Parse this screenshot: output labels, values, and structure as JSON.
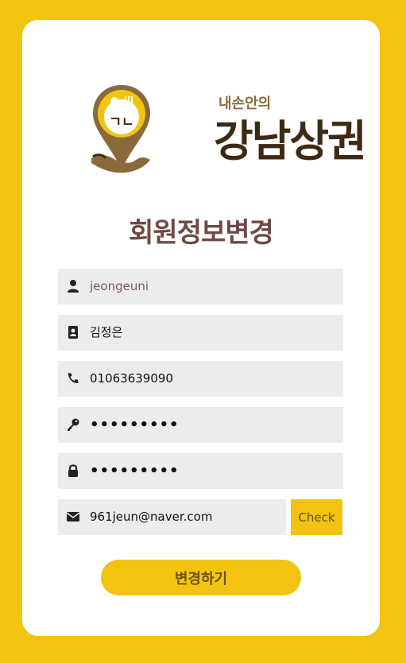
{
  "logo": {
    "subtitle": "내손안의",
    "name": "강남상권",
    "pin_text": "ㄱㄴ"
  },
  "title": "회원정보변경",
  "fields": {
    "username": {
      "icon": "user-icon",
      "value": "jeongeuni"
    },
    "name": {
      "icon": "id-card-icon",
      "value": "김정은"
    },
    "phone": {
      "icon": "phone-icon",
      "value": "01063639090"
    },
    "password": {
      "icon": "key-icon",
      "value": "•••••••••"
    },
    "password_confirm": {
      "icon": "lock-icon",
      "value": "•••••••••"
    },
    "email": {
      "icon": "envelope-icon",
      "value": "961jeun@naver.com"
    }
  },
  "buttons": {
    "check_label": "Check",
    "submit_label": "변경하기"
  },
  "colors": {
    "background": "#f2c411",
    "card": "#ffffff",
    "field": "#ececec",
    "title": "#6e4a45",
    "button_text": "#6b5212"
  }
}
